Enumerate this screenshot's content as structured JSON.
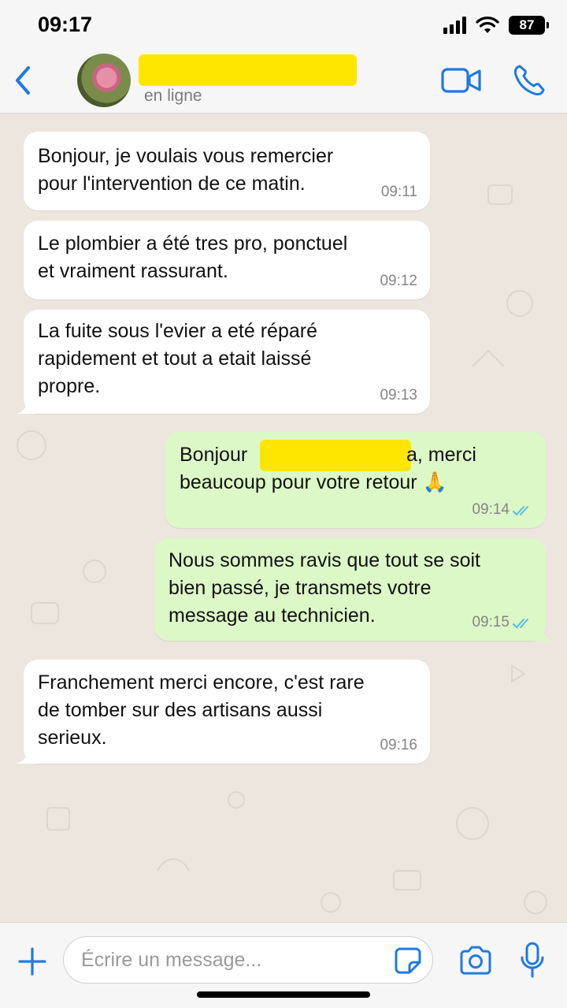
{
  "status_bar": {
    "time": "09:17",
    "battery": "87"
  },
  "header": {
    "contact_status": "en ligne",
    "accent_color": "#1f7ae0"
  },
  "messages": [
    {
      "direction": "incoming",
      "text": "Bonjour, je voulais vous remercier\npour l'intervention de ce matin.",
      "time": "09:11"
    },
    {
      "direction": "incoming",
      "text": "Le plombier a été tres pro, ponctuel\net vraiment rassurant.",
      "time": "09:12"
    },
    {
      "direction": "incoming",
      "text": "La fuite sous l'evier a eté réparé\nrapidement et tout a etait laissé\npropre.",
      "time": "09:13"
    },
    {
      "direction": "outgoing",
      "text_before": "Bonjour",
      "text_after": "a, merci",
      "text_line2": "beaucoup pour votre retour 🙏",
      "time": "09:14",
      "status": "read"
    },
    {
      "direction": "outgoing",
      "text": "Nous sommes ravis que tout se soit\nbien passé, je transmets votre\nmessage au technicien.",
      "time": "09:15",
      "status": "read"
    },
    {
      "direction": "incoming",
      "text": "Franchement merci encore, c'est rare\nde tomber sur des artisans aussi\nserieux.",
      "time": "09:16"
    }
  ],
  "input": {
    "placeholder": "Écrire un message..."
  },
  "colors": {
    "incoming_bubble": "#ffffff",
    "outgoing_bubble": "#dcf8c6",
    "read_ticks": "#53bdeb",
    "redaction": "#ffe600"
  }
}
